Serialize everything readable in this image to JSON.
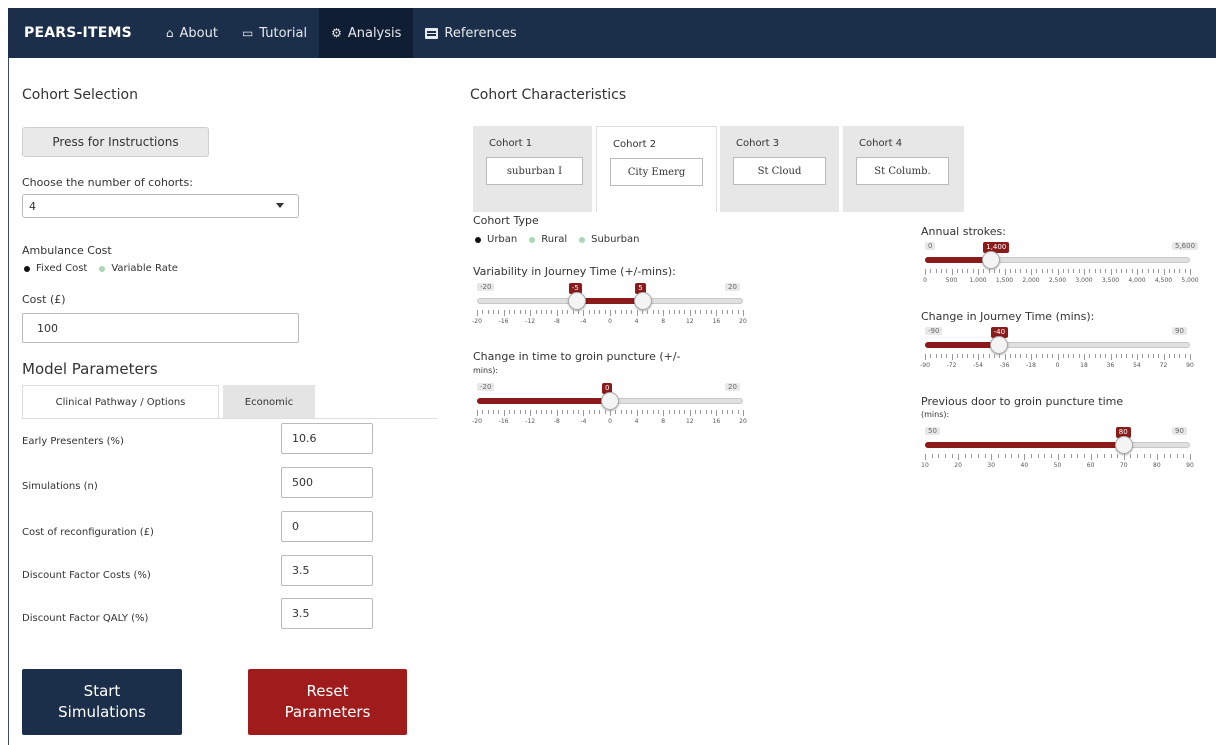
{
  "navbar": {
    "brand": "PEARS-ITEMS",
    "items": [
      {
        "label": "About",
        "icon": "home-icon"
      },
      {
        "label": "Tutorial",
        "icon": "clipboard-icon"
      },
      {
        "label": "Analysis",
        "icon": "cogs-icon",
        "active": true
      },
      {
        "label": "References",
        "icon": "book-icon"
      }
    ]
  },
  "cohort_selection": {
    "title": "Cohort Selection",
    "instructions_button": "Press for Instructions",
    "num_cohorts_label": "Choose the number of cohorts:",
    "num_cohorts_value": "4",
    "ambulance_cost_label": "Ambulance Cost",
    "ambulance_options": [
      "Fixed Cost",
      "Variable Rate"
    ],
    "ambulance_selected": "Fixed Cost",
    "cost_label": "Cost (£)",
    "cost_value": "100"
  },
  "model_parameters": {
    "title": "Model Parameters",
    "tabs": [
      "Clinical Pathway / Options",
      "Economic"
    ],
    "active_tab": "Clinical Pathway / Options",
    "fields": [
      {
        "label": "Early Presenters (%)",
        "value": "10.6"
      },
      {
        "label": "Simulations (n)",
        "value": "500"
      },
      {
        "label": "Cost of reconfiguration (£)",
        "value": "0"
      },
      {
        "label": "Discount Factor Costs (%)",
        "value": "3.5"
      },
      {
        "label": "Discount Factor QALY (%)",
        "value": "3.5"
      }
    ]
  },
  "buttons": {
    "start": {
      "line1": "Start",
      "line2": "Simulations"
    },
    "reset": {
      "line1": "Reset",
      "line2": "Parameters"
    }
  },
  "cohort_characteristics": {
    "title": "Cohort Characteristics",
    "tabs": [
      {
        "label": "Cohort 1",
        "value": "suburban I"
      },
      {
        "label": "Cohort 2",
        "value": "City Emerg",
        "active": true
      },
      {
        "label": "Cohort 3",
        "value": "St Cloud"
      },
      {
        "label": "Cohort 4",
        "value": "St Columb."
      }
    ],
    "cohort_type_label": "Cohort Type",
    "cohort_type_options": [
      "Urban",
      "Rural",
      "Suburban"
    ],
    "cohort_type_selected": "Urban",
    "sliders": {
      "variability": {
        "label": "Variability in Journey Time (+/-mins):",
        "min": "-20",
        "max": "20",
        "low": "-5",
        "high": "5",
        "low_value": -5,
        "high_value": 5,
        "ticks": [
          "-20",
          "-16",
          "-12",
          "-8",
          "-4",
          "0",
          "4",
          "8",
          "12",
          "16",
          "20"
        ]
      },
      "groin": {
        "label": "Change in time to groin puncture (+/-",
        "sublabel": "mins):",
        "min": "-20",
        "max": "20",
        "value_label": "0",
        "value": 0,
        "ticks": [
          "-20",
          "-16",
          "-12",
          "-8",
          "-4",
          "0",
          "4",
          "8",
          "12",
          "16",
          "20"
        ]
      },
      "annual": {
        "label": "Annual strokes:",
        "min": "0",
        "max": "5,600",
        "value_label": "1,400",
        "value": 1400,
        "ticks": [
          "0",
          "500",
          "1,000",
          "1,500",
          "2,000",
          "2,500",
          "3,000",
          "3,500",
          "4,000",
          "4,500",
          "5,000"
        ]
      },
      "journey": {
        "label": "Change in Journey Time (mins):",
        "min": "-90",
        "max": "90",
        "value_label": "-40",
        "value": -40,
        "ticks": [
          "-90",
          "-72",
          "-54",
          "-36",
          "-18",
          "0",
          "18",
          "36",
          "54",
          "72",
          "90"
        ]
      },
      "door": {
        "label": "Previous door to groin puncture time",
        "sublabel": "(mins):",
        "min": "50",
        "max": "90",
        "value_label": "80",
        "value": 80,
        "ticks": [
          "10",
          "20",
          "30",
          "40",
          "50",
          "60",
          "70",
          "80",
          "90"
        ]
      }
    }
  },
  "colors": {
    "navbar": "#1c2f4a",
    "start_button": "#1c2f4a",
    "reset_button": "#a01c1c",
    "slider_fill": "#8b1a1a"
  }
}
